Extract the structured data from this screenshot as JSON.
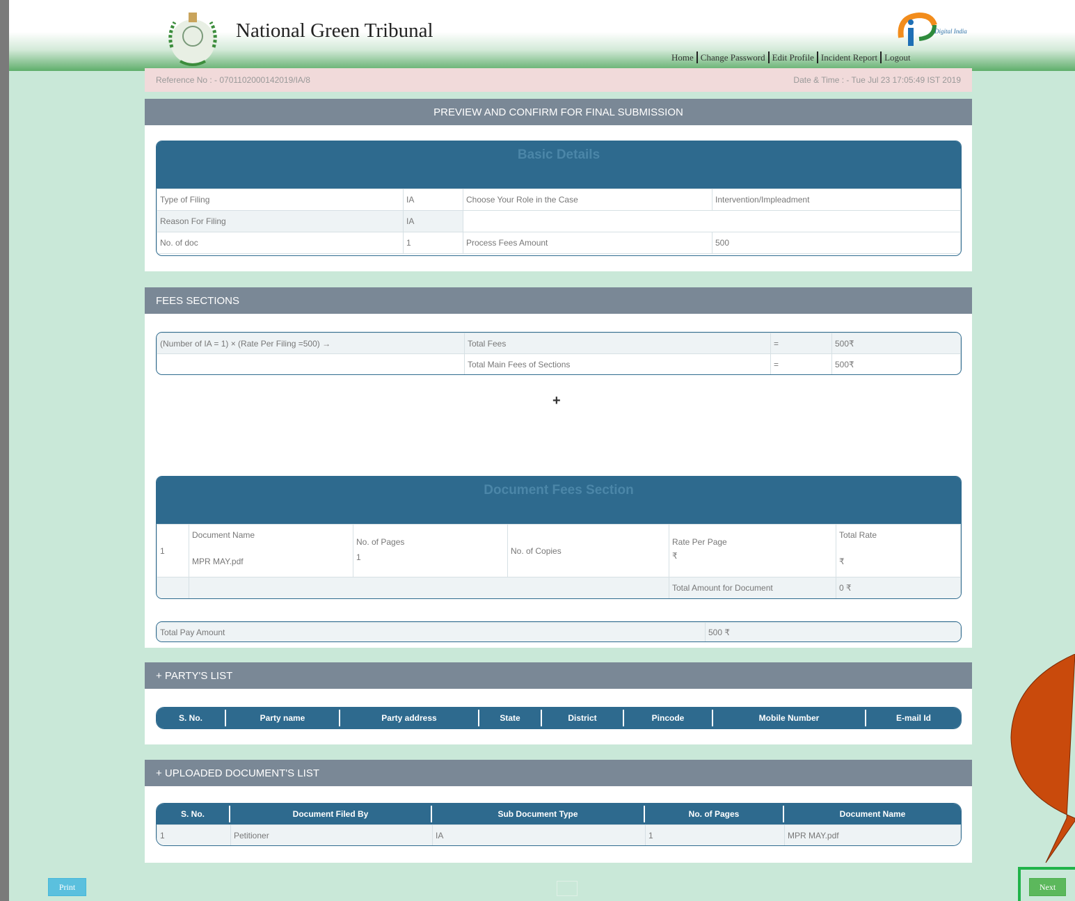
{
  "header": {
    "title": "National Green Tribunal",
    "digital_india_label": "Digital India",
    "nav": [
      "Home",
      "Change Password",
      "Edit Profile",
      "Incident Report",
      "Logout"
    ]
  },
  "info_bar": {
    "reference": "Reference No : - 0701102000142019/IA/8",
    "datetime": "Date & Time : - Tue Jul 23 17:05:49 IST 2019"
  },
  "preview": {
    "heading": "PREVIEW AND CONFIRM FOR FINAL SUBMISSION",
    "basic_details_title": "Basic Details",
    "rows": [
      [
        "Type of Filing",
        "IA",
        "Choose Your Role in the Case",
        "Intervention/Impleadment"
      ],
      [
        "Reason For Filing",
        "IA",
        "",
        ""
      ],
      [
        "No. of doc",
        "1",
        "Process Fees Amount",
        "500"
      ]
    ]
  },
  "fees": {
    "heading": "FEES SECTIONS",
    "rows": [
      [
        "(Number of IA = 1) × (Rate Per Filing =500) →",
        "Total Fees",
        "=",
        "500₹"
      ],
      [
        "",
        "Total Main Fees of Sections",
        "=",
        "500₹"
      ]
    ],
    "plus_symbol": "+",
    "doc_fees_title": "Document Fees Section",
    "doc": {
      "index": "1",
      "name_label": "Document Name",
      "name_value": "MPR MAY.pdf",
      "pages_label": "No. of Pages",
      "pages_value": "1",
      "copies_label": "No. of Copies",
      "rate_label": "Rate Per Page",
      "rate_value": "₹",
      "total_label": "Total Rate",
      "total_value": "₹",
      "total_amount_label": "Total Amount for Document",
      "total_amount_value": "0 ₹"
    },
    "total_pay_label": "Total Pay Amount",
    "total_pay_value": "500 ₹"
  },
  "party_list": {
    "heading": "+ PARTY'S LIST",
    "columns": [
      "S. No.",
      "Party name",
      "Party address",
      "State",
      "District",
      "Pincode",
      "Mobile Number",
      "E-mail Id"
    ]
  },
  "documents_list": {
    "heading": "+ UPLOADED DOCUMENT'S LIST",
    "columns": [
      "S. No.",
      "Document Filed By",
      "Sub Document Type",
      "No. of Pages",
      "Document Name"
    ],
    "rows": [
      [
        "1",
        "Petitioner",
        "IA",
        "1",
        "MPR MAY.pdf"
      ]
    ]
  },
  "actions": {
    "print_label": "Print",
    "next_label": "Next"
  },
  "colors": {
    "panel_header": "#7a8896",
    "table_header": "#2e6a8e",
    "callout": "#c94a0c",
    "highlight": "#20b34a"
  }
}
